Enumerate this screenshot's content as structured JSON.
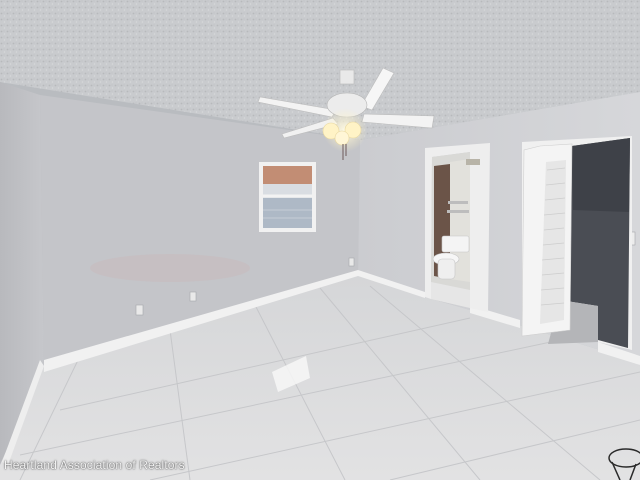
{
  "photo": {
    "watermark": "Heartland Association of Realtors",
    "colors": {
      "ceiling": "#c9cbce",
      "wall_left": "#c3c4c8",
      "wall_back": "#c8c9cc",
      "wall_right": "#cfd0d3",
      "floor": "#d8d9db",
      "baseboard": "#f1f1f1"
    }
  }
}
